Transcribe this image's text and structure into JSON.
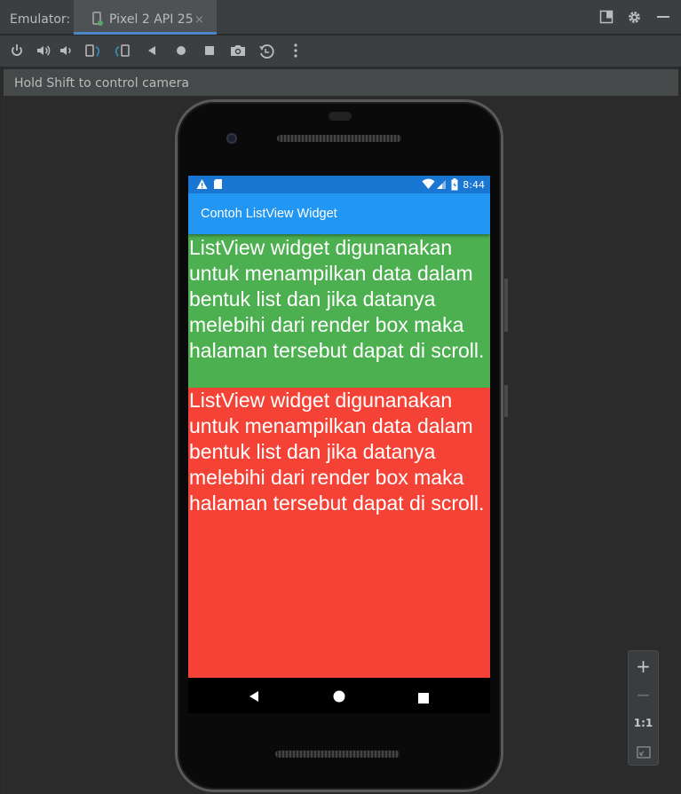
{
  "tabbar": {
    "label": "Emulator:",
    "tab_title": "Pixel 2 API 25",
    "tab_close": "×"
  },
  "infobar": {
    "message": "Hold Shift to control camera"
  },
  "phone": {
    "statusbar": {
      "time": "8:44"
    },
    "appbar": {
      "title": "Contoh ListView Widget"
    },
    "items": [
      "ListView widget digunanakan untuk menampilkan data dalam bentuk list dan jika datanya melebihi dari render box maka halaman tersebut dapat di scroll.",
      "ListView widget digunanakan untuk menampilkan data dalam bentuk list dan jika datanya melebihi dari render box maka halaman tersebut dapat di scroll."
    ],
    "colors": {
      "appbar": "#2196f3",
      "statusbar": "#1976d2",
      "item_1": "#4caf50",
      "item_2": "#f44336"
    }
  },
  "zoom": {
    "zoom_in": "+",
    "zoom_out": "−",
    "actual_size": "1:1"
  },
  "colors": {
    "accent": "#4a88c7",
    "panel": "#3c3f41",
    "background": "#2b2b2b"
  }
}
